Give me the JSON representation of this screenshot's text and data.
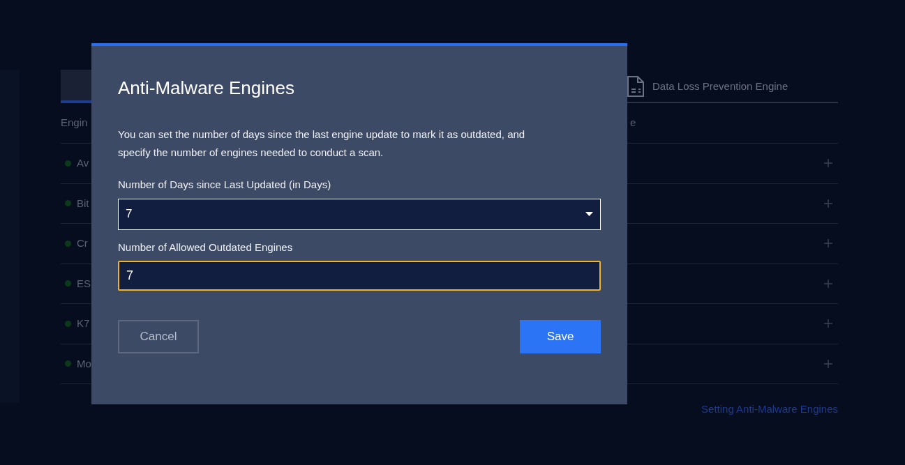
{
  "tabs": [
    {
      "selected": true
    },
    {
      "label": "Data Loss Prevention Engine",
      "selected": false
    }
  ],
  "table": {
    "columns": [
      "Engin",
      "e"
    ],
    "rows": [
      {
        "name": "Av"
      },
      {
        "name": "Bit"
      },
      {
        "name": "Cr"
      },
      {
        "name": "ES"
      },
      {
        "name": "K7"
      },
      {
        "name": "Mo"
      }
    ]
  },
  "footer_link": "Setting Anti-Malware Engines",
  "dialog": {
    "title": "Anti-Malware Engines",
    "description": "You can set the number of days since the last engine update to mark it as outdated, and specify the number of engines needed to conduct a scan.",
    "fields": [
      {
        "kind": "select",
        "label": "Number of Days since Last Updated (in Days)",
        "value": "7",
        "focused": false
      },
      {
        "kind": "input",
        "label": "Number of Allowed Outdated Engines",
        "value": "7",
        "focused": true
      }
    ],
    "buttons": [
      {
        "kind": "secondary",
        "label": "Cancel"
      },
      {
        "kind": "primary",
        "label": "Save"
      }
    ]
  }
}
